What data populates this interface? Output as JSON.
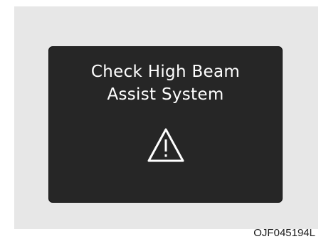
{
  "display": {
    "line1": "Check High Beam",
    "line2": "Assist System",
    "icon": "warning-triangle-icon",
    "background_color": "#262626",
    "text_color": "#ffffff"
  },
  "figure_code": "OJF045194L",
  "panel_color": "#e7e7e7"
}
